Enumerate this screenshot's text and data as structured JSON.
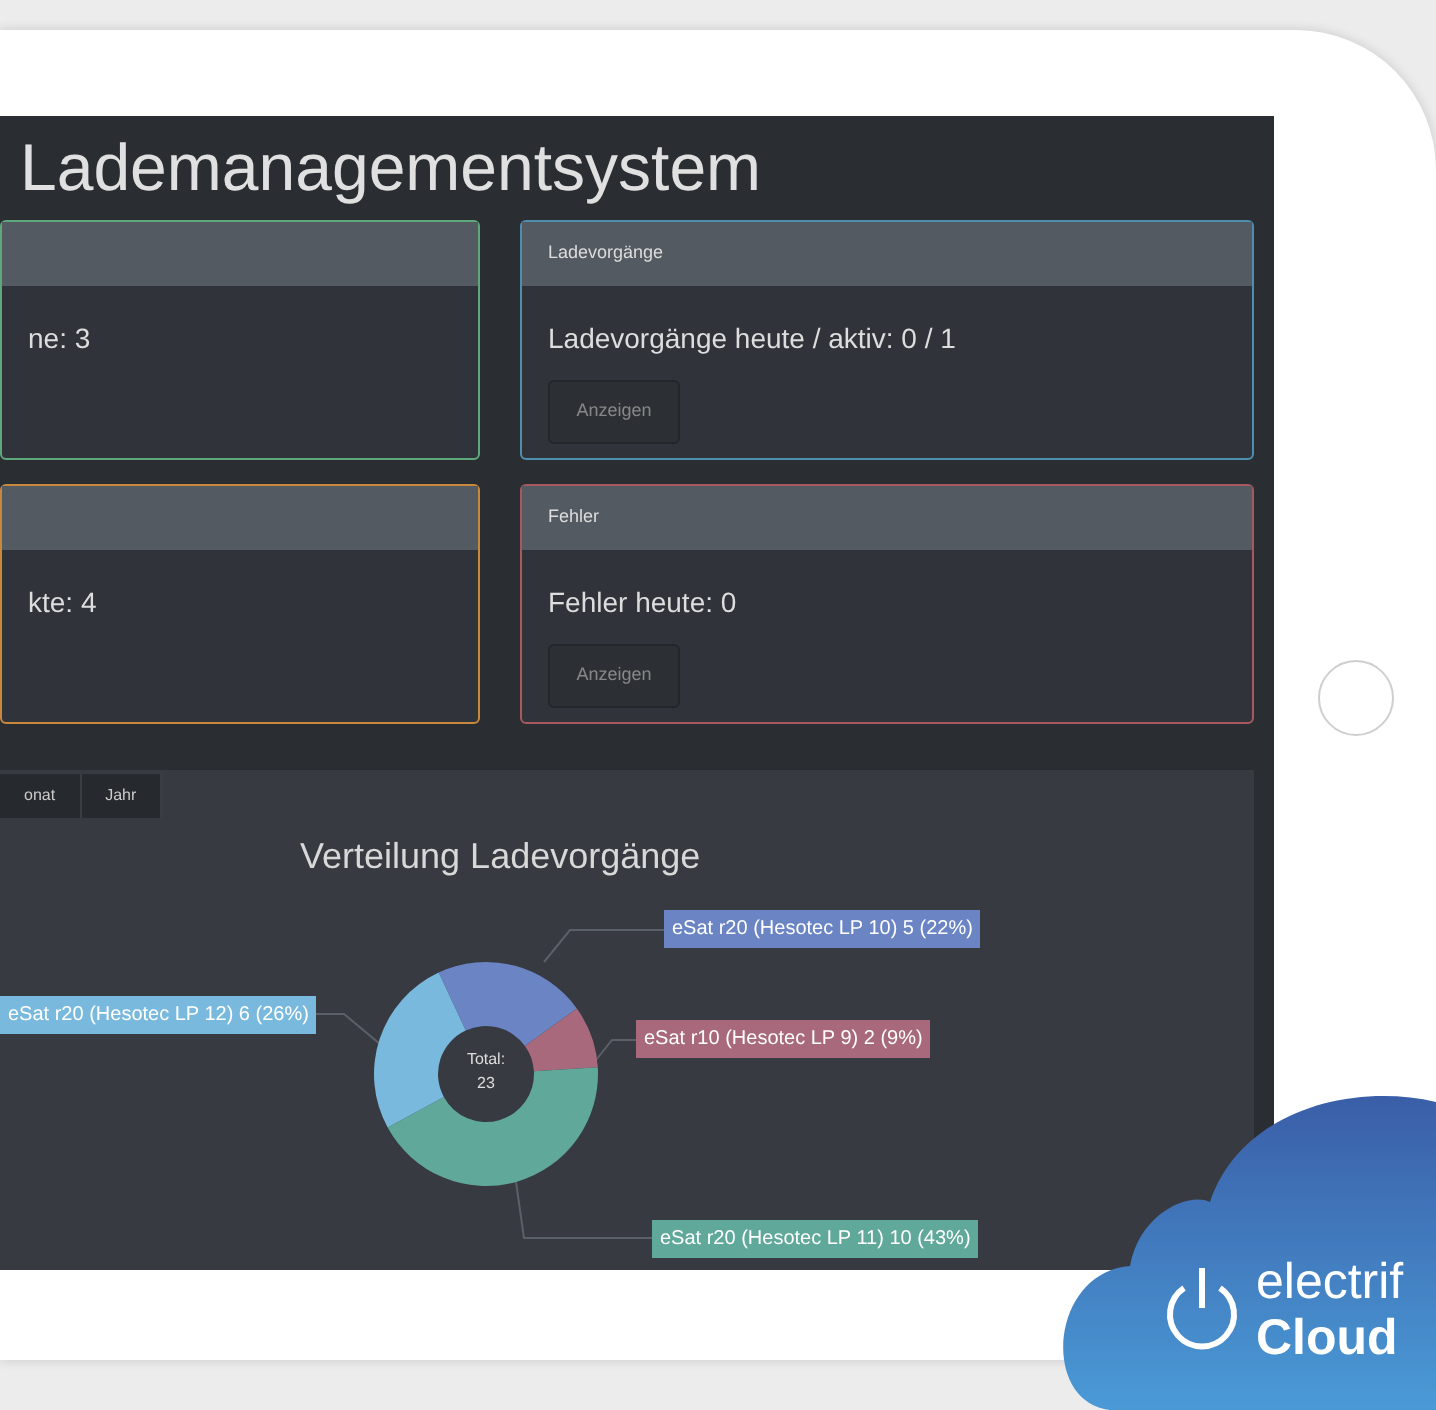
{
  "title": "Lademanagementsystem",
  "cards": [
    {
      "text": "ne: 3",
      "color": "#5fa87a"
    },
    {
      "header": "Ladevorgänge",
      "text": "Ladevorgänge heute / aktiv: 0 / 1",
      "button": "Anzeigen",
      "color": "#4f8fae"
    },
    {
      "text": "kte: 4",
      "color": "#c8893c"
    },
    {
      "header": "Fehler",
      "text": "Fehler heute: 0",
      "button": "Anzeigen",
      "color": "#a65a5e"
    }
  ],
  "chart_panel": {
    "tabs": [
      "onat",
      "Jahr"
    ],
    "chart_data": {
      "type": "donut",
      "title": "Verteilung Ladevorgänge",
      "value_labels": [
        "eSat r20 (Hesotec LP 10) 5 (22%)",
        "eSat r10 (Hesotec LP 9) 2 (9%)",
        "eSat r20 (Hesotec LP 11) 10 (43%)",
        "eSat r20 (Hesotec LP 12) 6 (26%)"
      ],
      "values": [
        22,
        9,
        43,
        26
      ],
      "colors": [
        "#6a84c4",
        "#a8697c",
        "#5fa89a",
        "#7ab9de"
      ]
    },
    "center_label": "Total:",
    "center_value": "23"
  },
  "logo": {
    "line1": "electrif",
    "line2": "Cloud"
  }
}
